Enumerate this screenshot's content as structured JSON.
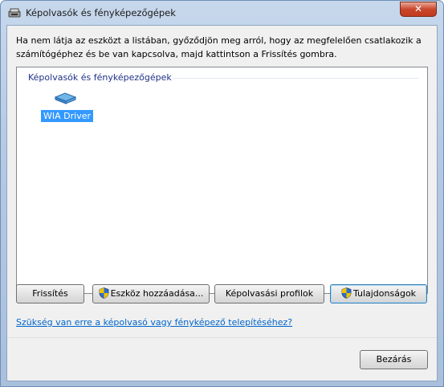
{
  "window": {
    "title": "Képolvasók és fényképezőgépek",
    "close_label": "✕"
  },
  "intro_text": "Ha nem látja az eszközt a listában, győződjön meg arról, hogy az megfelelően csatlakozik a számítógéphez és be van kapcsolva, majd kattintson a Frissítés gombra.",
  "device_list": {
    "group_header": "Képolvasók és fényképezőgépek",
    "items": [
      {
        "label": "WIA Driver",
        "icon": "scanner-icon",
        "selected": true
      }
    ]
  },
  "buttons": {
    "refresh": "Frissítés",
    "add_device": "Eszköz hozzáadása...",
    "scan_profiles": "Képolvasási profilok",
    "properties": "Tulajdonságok",
    "close": "Bezárás"
  },
  "help_link": "Szükség van erre a képolvasó vagy fényképező telepítéséhez?"
}
